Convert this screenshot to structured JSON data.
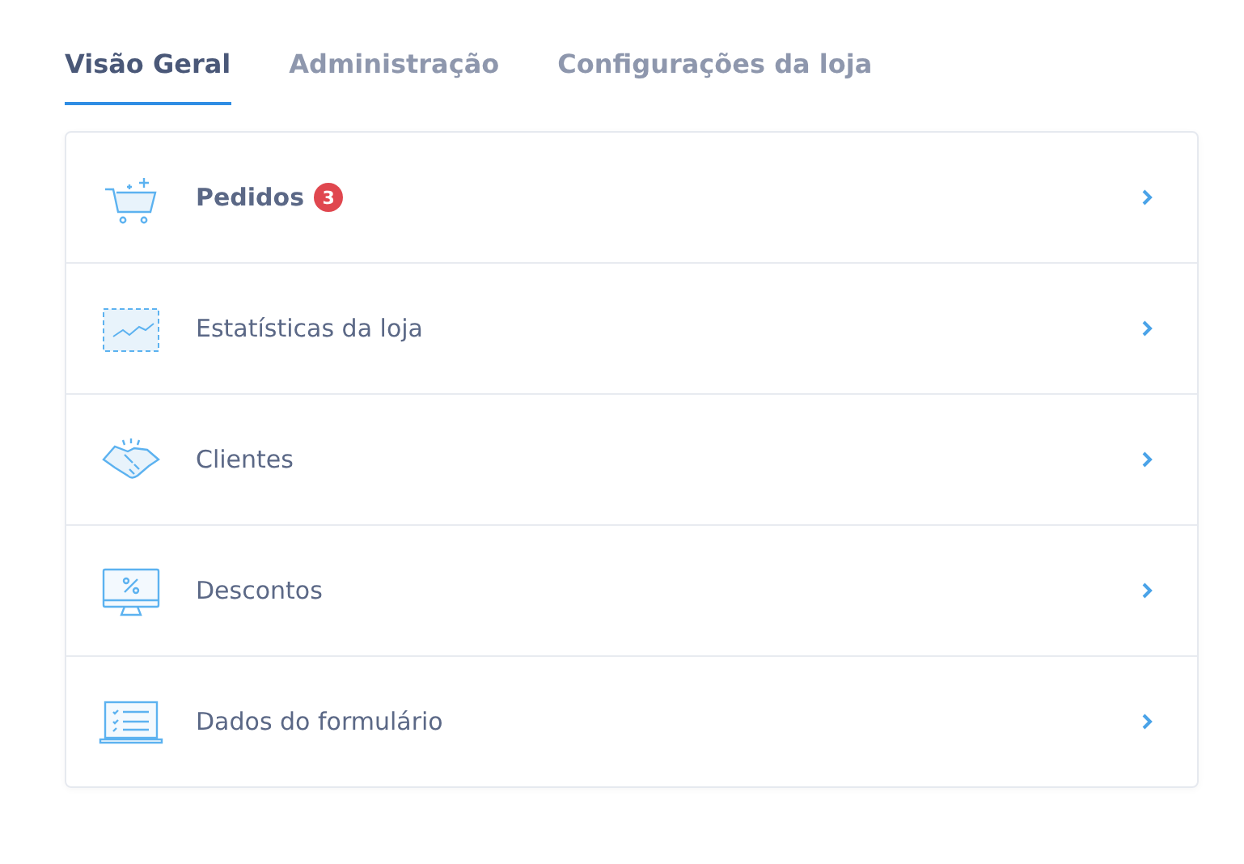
{
  "tabs": [
    {
      "label": "Visão Geral",
      "selected": true
    },
    {
      "label": "Administração",
      "selected": false
    },
    {
      "label": "Configurações da loja",
      "selected": false
    }
  ],
  "items": [
    {
      "kind": "cart",
      "label": "Pedidos",
      "bold": true,
      "badge": "3"
    },
    {
      "kind": "stats",
      "label": "Estatísticas da loja",
      "bold": false
    },
    {
      "kind": "handshake",
      "label": "Clientes",
      "bold": false
    },
    {
      "kind": "discount",
      "label": "Descontos",
      "bold": false
    },
    {
      "kind": "form",
      "label": "Dados do formulário",
      "bold": false
    }
  ]
}
